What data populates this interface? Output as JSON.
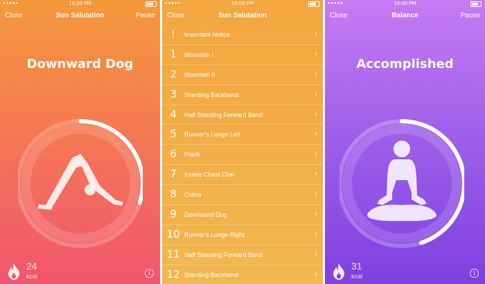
{
  "panel1": {
    "status": {
      "signal": "●●●●●",
      "time": "10:00 PM"
    },
    "nav": {
      "left": "Close",
      "title": "Sun Salutation",
      "right": "Pause"
    },
    "pose_title": "Downward Dog",
    "progress": 0.3,
    "kcal_value": "24",
    "kcal_unit": "kcal",
    "info": "i"
  },
  "panel2": {
    "status": {
      "signal": "●●●●●",
      "time": "10:00 PM"
    },
    "nav": {
      "left": "Close",
      "title": "Sun Salutation"
    },
    "items": [
      {
        "num": "!",
        "label": "Important Notice"
      },
      {
        "num": "1",
        "label": "Mountain I"
      },
      {
        "num": "2",
        "label": "Mountain II"
      },
      {
        "num": "3",
        "label": "Standing Backbend"
      },
      {
        "num": "4",
        "label": "Half Standing Forward Bend"
      },
      {
        "num": "5",
        "label": "Runner's Lunge Left"
      },
      {
        "num": "6",
        "label": "Plank"
      },
      {
        "num": "7",
        "label": "Knees Chest Chin"
      },
      {
        "num": "8",
        "label": "Cobra"
      },
      {
        "num": "9",
        "label": "Downward Dog"
      },
      {
        "num": "10",
        "label": "Runner's Lunge Right"
      },
      {
        "num": "11",
        "label": "Half Standing Forward Bend"
      },
      {
        "num": "12",
        "label": "Standing Backbend"
      }
    ],
    "chevron": "›"
  },
  "panel3": {
    "status": {
      "signal": "●●●●●",
      "time": "10:00 PM"
    },
    "nav": {
      "left": "Close",
      "title": "Balance",
      "right": "Pause"
    },
    "pose_title": "Accomplished",
    "progress": 0.45,
    "kcal_value": "31",
    "kcal_unit": "kcal",
    "info": "i"
  },
  "colors": {
    "accent_orange": "#f47a52",
    "accent_purple": "#9c5ee9"
  },
  "icons": {
    "flame": "flame-icon",
    "info": "info-icon",
    "chevron": "chevron-right-icon"
  }
}
